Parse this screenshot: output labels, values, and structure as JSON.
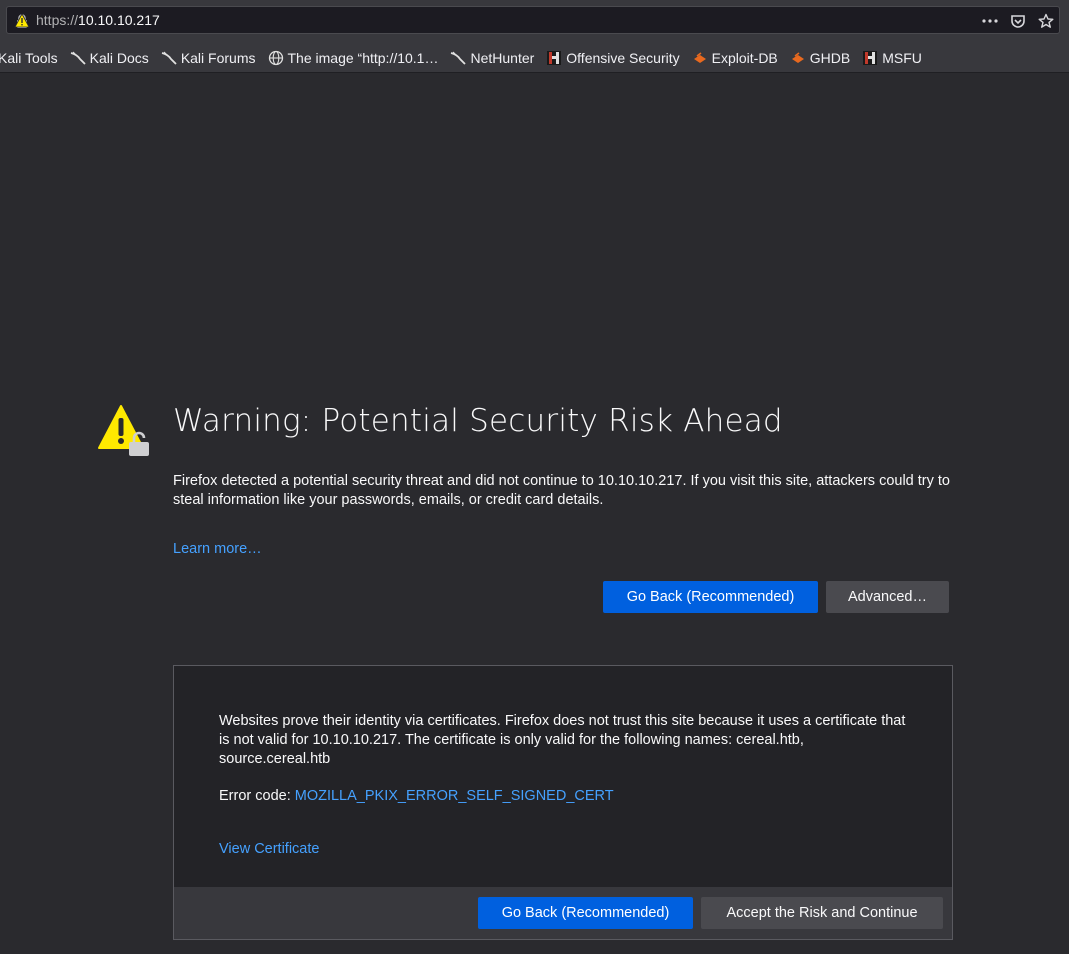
{
  "urlbar": {
    "protocol": "https://",
    "host": "10.10.10.217",
    "actions": [
      "page-actions-icon",
      "pocket-icon",
      "bookmark-star-icon"
    ]
  },
  "bookmarks": [
    {
      "label": "Kali Tools",
      "icon": "kali-dragon-icon"
    },
    {
      "label": "Kali Docs",
      "icon": "kali-dragon-icon"
    },
    {
      "label": "Kali Forums",
      "icon": "kali-dragon-icon"
    },
    {
      "label": "The image “http://10.1…",
      "icon": "globe-icon"
    },
    {
      "label": "NetHunter",
      "icon": "kali-dragon-icon"
    },
    {
      "label": "Offensive Security",
      "icon": "offsec-icon"
    },
    {
      "label": "Exploit-DB",
      "icon": "exploitdb-icon"
    },
    {
      "label": "GHDB",
      "icon": "exploitdb-icon"
    },
    {
      "label": "MSFU",
      "icon": "offsec-icon"
    }
  ],
  "error_page": {
    "title": "Warning: Potential Security Risk Ahead",
    "description": "Firefox detected a potential security threat and did not continue to 10.10.10.217. If you visit this site, attackers could try to steal information like your passwords, emails, or credit card details.",
    "learn_more": "Learn more…",
    "go_back": "Go Back (Recommended)",
    "advanced": "Advanced…",
    "advanced_panel": {
      "text": "Websites prove their identity via certificates. Firefox does not trust this site because it uses a certificate that is not valid for 10.10.10.217. The certificate is only valid for the following names: cereal.htb, source.cereal.htb",
      "error_code_label": "Error code: ",
      "error_code": "MOZILLA_PKIX_ERROR_SELF_SIGNED_CERT",
      "view_certificate": "View Certificate",
      "go_back": "Go Back (Recommended)",
      "accept": "Accept the Risk and Continue"
    }
  },
  "colors": {
    "background": "#2a2a2e",
    "primary_button": "#0060df",
    "link": "#45a1ff",
    "warning_yellow": "#ffe900"
  }
}
